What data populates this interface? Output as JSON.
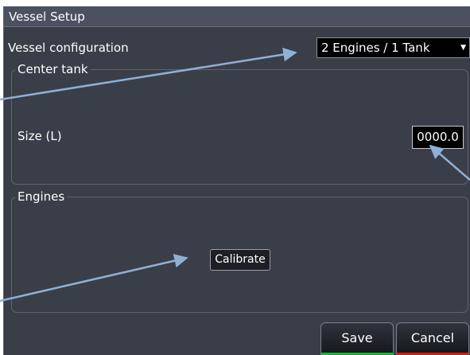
{
  "dialog": {
    "title": "Vessel Setup",
    "vessel_configuration_label": "Vessel configuration",
    "vessel_configuration_value": "2 Engines / 1 Tank",
    "center_tank": {
      "legend": "Center tank",
      "size_label": "Size (L)",
      "size_value": "0000.0"
    },
    "engines": {
      "legend": "Engines",
      "calibrate_label": "Calibrate"
    },
    "footer": {
      "save_label": "Save",
      "cancel_label": "Cancel"
    }
  },
  "colors": {
    "panel": "#3a3e48",
    "titlebar": "#4c5161",
    "annotation_arrow": "#8fb0d6",
    "save_accent": "#1fae3d",
    "cancel_accent": "#c0231c"
  }
}
